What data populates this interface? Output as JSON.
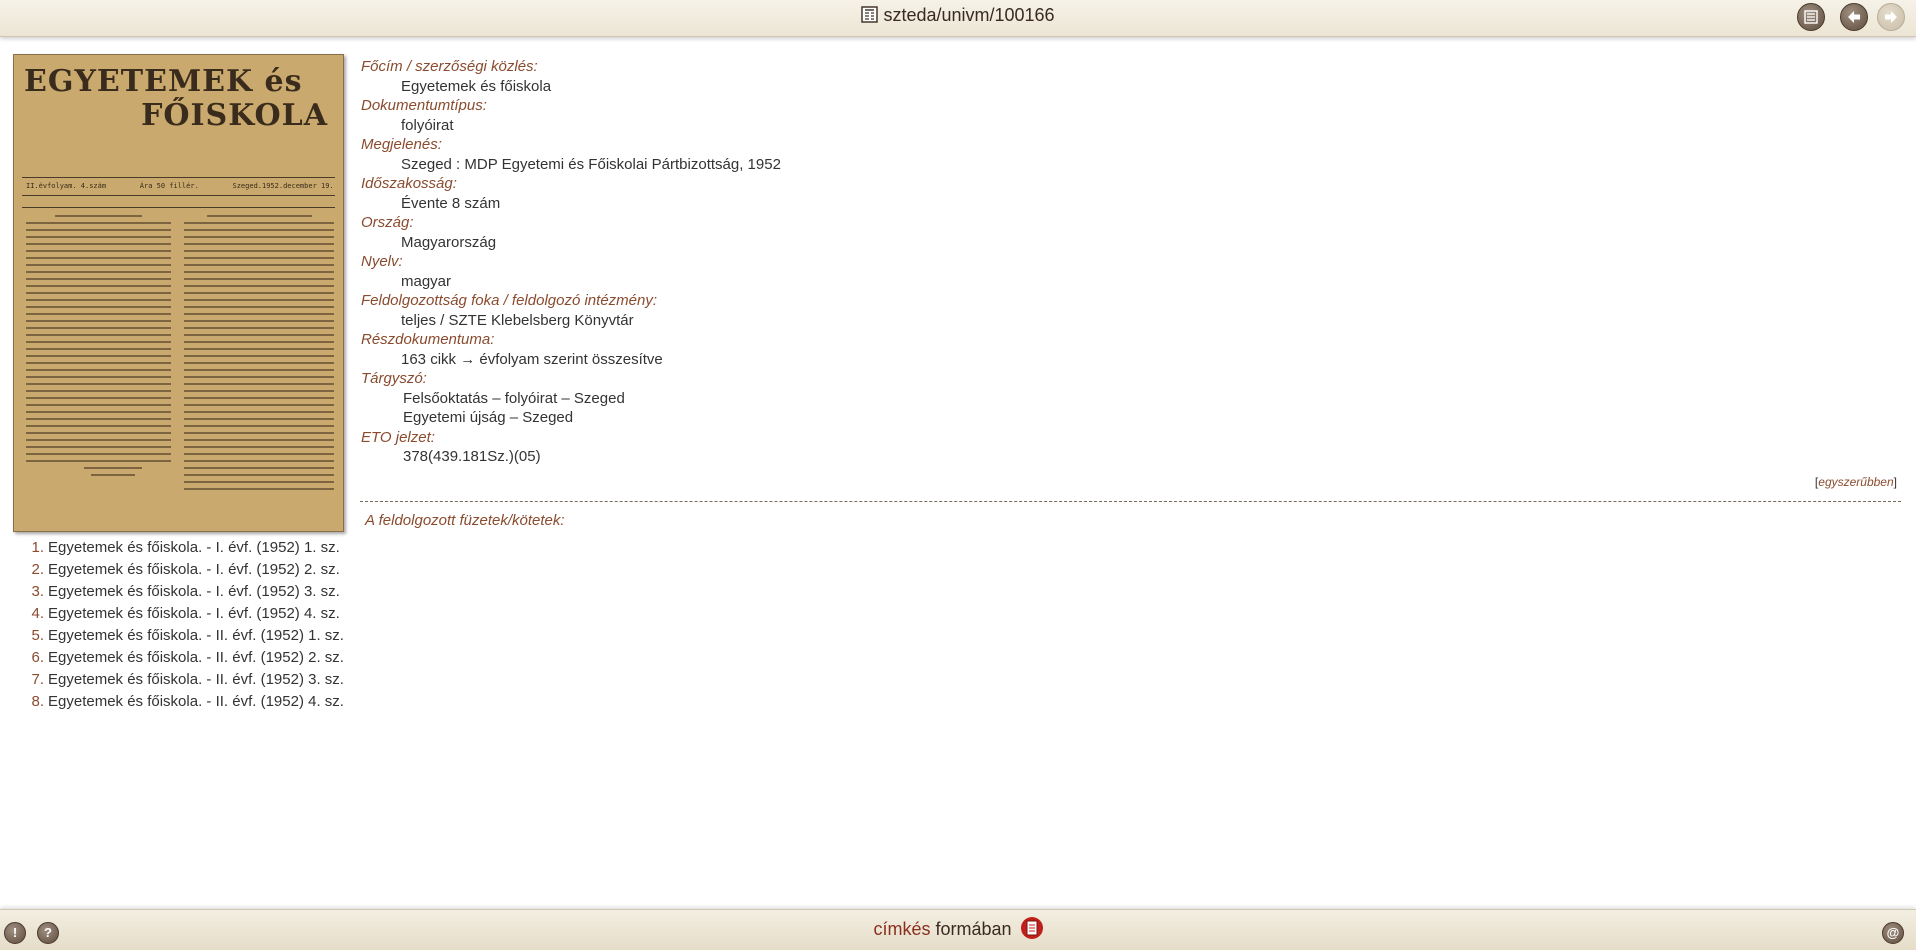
{
  "header": {
    "title": "szteda/univm/100166",
    "buttons": {
      "list": "list-icon",
      "back": "arrow-left-icon",
      "forward": "arrow-right-icon"
    }
  },
  "cover": {
    "masthead_line1": "EGYETEMEK és",
    "masthead_line2": "FŐISKOLA",
    "issue_line": "II.évfolyam. 4.szám        Ára 50 fillér.        Szeged.1952.december 19."
  },
  "fields": [
    {
      "label": "Főcím / szerzőségi közlés:",
      "values": [
        "Egyetemek és főiskola"
      ]
    },
    {
      "label": "Dokumentumtípus:",
      "values": [
        "folyóirat"
      ]
    },
    {
      "label": "Megjelenés:",
      "values": [
        "Szeged : MDP Egyetemi és Főiskolai Pártbizottság, 1952"
      ]
    },
    {
      "label": "Időszakosság:",
      "values": [
        "Évente 8 szám"
      ]
    },
    {
      "label": "Ország:",
      "values": [
        "Magyarország"
      ]
    },
    {
      "label": "Nyelv:",
      "values": [
        "magyar"
      ]
    },
    {
      "label": "Feldolgozottság foka / feldolgozó intézmény:",
      "values": [
        "teljes / SZTE Klebelsberg Könyvtár"
      ]
    },
    {
      "label": "Részdokumentuma:",
      "values": [
        "163 cikk → évfolyam szerint összesítve"
      ]
    },
    {
      "label": "Tárgyszó:",
      "values": [
        "Felsőoktatás – folyóirat – Szeged",
        "Egyetemi újság – Szeged"
      ]
    },
    {
      "label": "ETO jelzet:",
      "values": [
        "378(439.181Sz.)(05)"
      ]
    }
  ],
  "simple_view": {
    "open": "[",
    "link": "egyszerűbben",
    "close": "]"
  },
  "processed_label": "A feldolgozott füzetek/kötetek:",
  "issues": [
    {
      "num": "1.",
      "text": "Egyetemek és főiskola. - I. évf. (1952) 1. sz."
    },
    {
      "num": "2.",
      "text": "Egyetemek és főiskola. - I. évf. (1952) 2. sz."
    },
    {
      "num": "3.",
      "text": "Egyetemek és főiskola. - I. évf. (1952) 3. sz."
    },
    {
      "num": "4.",
      "text": "Egyetemek és főiskola. - I. évf. (1952) 4. sz."
    },
    {
      "num": "5.",
      "text": "Egyetemek és főiskola. - II. évf. (1952) 1. sz."
    },
    {
      "num": "6.",
      "text": "Egyetemek és főiskola. - II. évf. (1952) 2. sz."
    },
    {
      "num": "7.",
      "text": "Egyetemek és főiskola. - II. évf. (1952) 3. sz."
    },
    {
      "num": "8.",
      "text": "Egyetemek és főiskola. - II. évf. (1952) 4. sz."
    }
  ],
  "footer": {
    "word1": "címkés",
    "word2": "formában",
    "left_buttons": [
      "!",
      "?"
    ],
    "right_button": "@"
  }
}
